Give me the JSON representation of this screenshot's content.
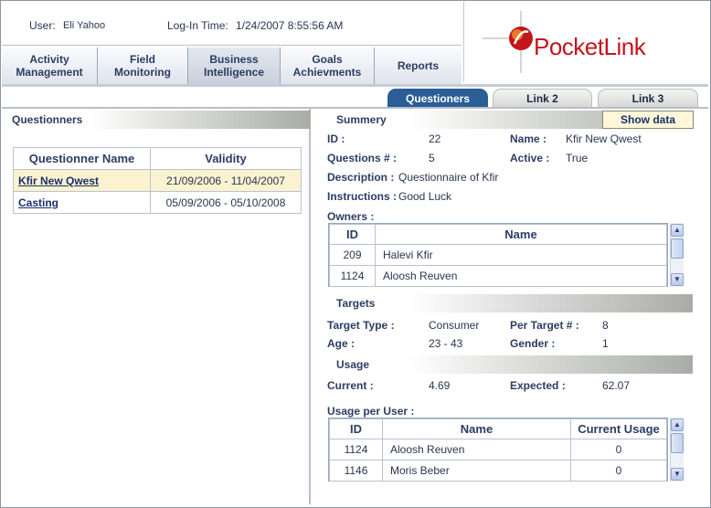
{
  "header": {
    "user_label": "User:",
    "user_value": "Eli Yahoo",
    "login_label": "Log-In Time:",
    "login_value": "1/24/2007 8:55:56 AM"
  },
  "menu": [
    {
      "label": "Activity\nManagement"
    },
    {
      "label": "Field\nMonitoring"
    },
    {
      "label": "Business\nIntelligence"
    },
    {
      "label": "Goals\nAchievments"
    },
    {
      "label": "Reports"
    }
  ],
  "logo": {
    "text_a": "Pocket",
    "text_b": "Link",
    "color": "#c2161d"
  },
  "tabs": [
    {
      "label": "Questioners"
    },
    {
      "label": "Link 2"
    },
    {
      "label": "Link 3"
    }
  ],
  "left": {
    "title": "Questionners",
    "columns": [
      "Questionner Name",
      "Validity"
    ],
    "rows": [
      {
        "name": "Kfir New Qwest",
        "validity": "21/09/2006  -  11/04/2007"
      },
      {
        "name": "Casting",
        "validity": "05/09/2006  -  05/10/2008"
      }
    ]
  },
  "summary": {
    "title": "Summery",
    "show_button": "Show data",
    "id_label": "ID :",
    "id_value": "22",
    "name_label": "Name :",
    "name_value": "Kfir New Qwest",
    "questions_label": "Questions # :",
    "questions_value": "5",
    "active_label": "Active :",
    "active_value": "True",
    "description_label": "Description :",
    "description_value": "Questionnaire of Kfir",
    "instructions_label": "Instructions :",
    "instructions_value": "Good Luck",
    "owners_label": "Owners :",
    "owners_columns": [
      "ID",
      "Name"
    ],
    "owners": [
      {
        "id": "209",
        "name": "Halevi Kfir"
      },
      {
        "id": "1124",
        "name": "Aloosh Reuven"
      }
    ]
  },
  "targets": {
    "title": "Targets",
    "type_label": "Target Type :",
    "type_value": "Consumer",
    "per_label": "Per Target # :",
    "per_value": "8",
    "age_label": "Age :",
    "age_value": "23 - 43",
    "gender_label": "Gender :",
    "gender_value": "1"
  },
  "usage": {
    "title": "Usage",
    "current_label": "Current :",
    "current_value": "4.69",
    "expected_label": "Expected :",
    "expected_value": "62.07",
    "per_user_label": "Usage per User :",
    "columns": [
      "ID",
      "Name",
      "Current Usage"
    ],
    "rows": [
      {
        "id": "1124",
        "name": "Aloosh Reuven",
        "usage": "0"
      },
      {
        "id": "1146",
        "name": "Moris Beber",
        "usage": "0"
      }
    ]
  }
}
